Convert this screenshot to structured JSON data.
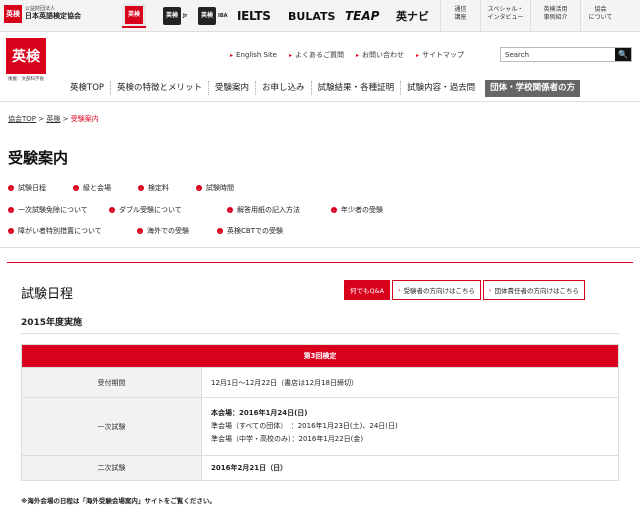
{
  "org": {
    "line1": "公益財団法人",
    "line2": "日本英語検定協会",
    "logo": "英検"
  },
  "brands": [
    {
      "tile": "英検",
      "sup": ""
    },
    {
      "tile": "英検",
      "sup": "Jr"
    },
    {
      "tile": "英検",
      "sup": "IBA"
    },
    {
      "label": "IELTS"
    },
    {
      "label": "BULATS"
    },
    {
      "label": "TEAP"
    },
    {
      "label": "英ナビ"
    }
  ],
  "topnav": [
    "通信\n講座",
    "スペシャル・\nインタビュー",
    "英検活用\n事例紹介",
    "協会\nについて"
  ],
  "header_logo": {
    "text": "英検",
    "sub": "後援：文部科学省"
  },
  "utility": [
    "English Site",
    "よくあるご質問",
    "お問い合わせ",
    "サイトマップ"
  ],
  "search": {
    "value": "Search",
    "button": "🔍"
  },
  "mainnav": [
    "英検TOP",
    "英検の特徴とメリット",
    "受験案内",
    "お申し込み",
    "試験結果・各種証明",
    "試験内容・過去問"
  ],
  "mainnav_highlight": "団体・学校関係者の方",
  "breadcrumb": {
    "home": "協会TOP",
    "sep": ">",
    "eiken": "英検",
    "current": "受験案内"
  },
  "page_title": "受験案内",
  "quick_links": [
    "試験日程",
    "級と会場",
    "検定料",
    "試験時間",
    "一次試験免除について",
    "ダブル受験について",
    "解答用紙の記入方法",
    "年少者の受験",
    "障がい者特別措置について",
    "海外での受験",
    "英検CBTでの受験"
  ],
  "section": {
    "title": "試験日程",
    "buttons": [
      "何でもQ&A",
      "受験者の方向けはこちら",
      "団体責任者の方向けはこちら"
    ],
    "year": "2015年度実施"
  },
  "table": {
    "header": "第3回検定",
    "rows": {
      "accept_label": "受付期間",
      "accept_value": "12月1日～12月22日（書店は12月18日締切）",
      "first_label": "一次試験",
      "first_main": "本会場：2016年1月24日(日)",
      "first_sub1": "準会場（すべての団体）　：2016年1月23日(土)、24日(日)",
      "first_sub2": "準会場（中学・高校のみ）：2016年1月22日(金)",
      "second_label": "二次試験",
      "second_value": "2016年2月21日（日）"
    }
  },
  "note": "※海外会場の日程は「海外受験会場案内」サイトをご覧ください。",
  "colors": {
    "accent": "#d9001b",
    "highlight_nav": "#666666"
  }
}
